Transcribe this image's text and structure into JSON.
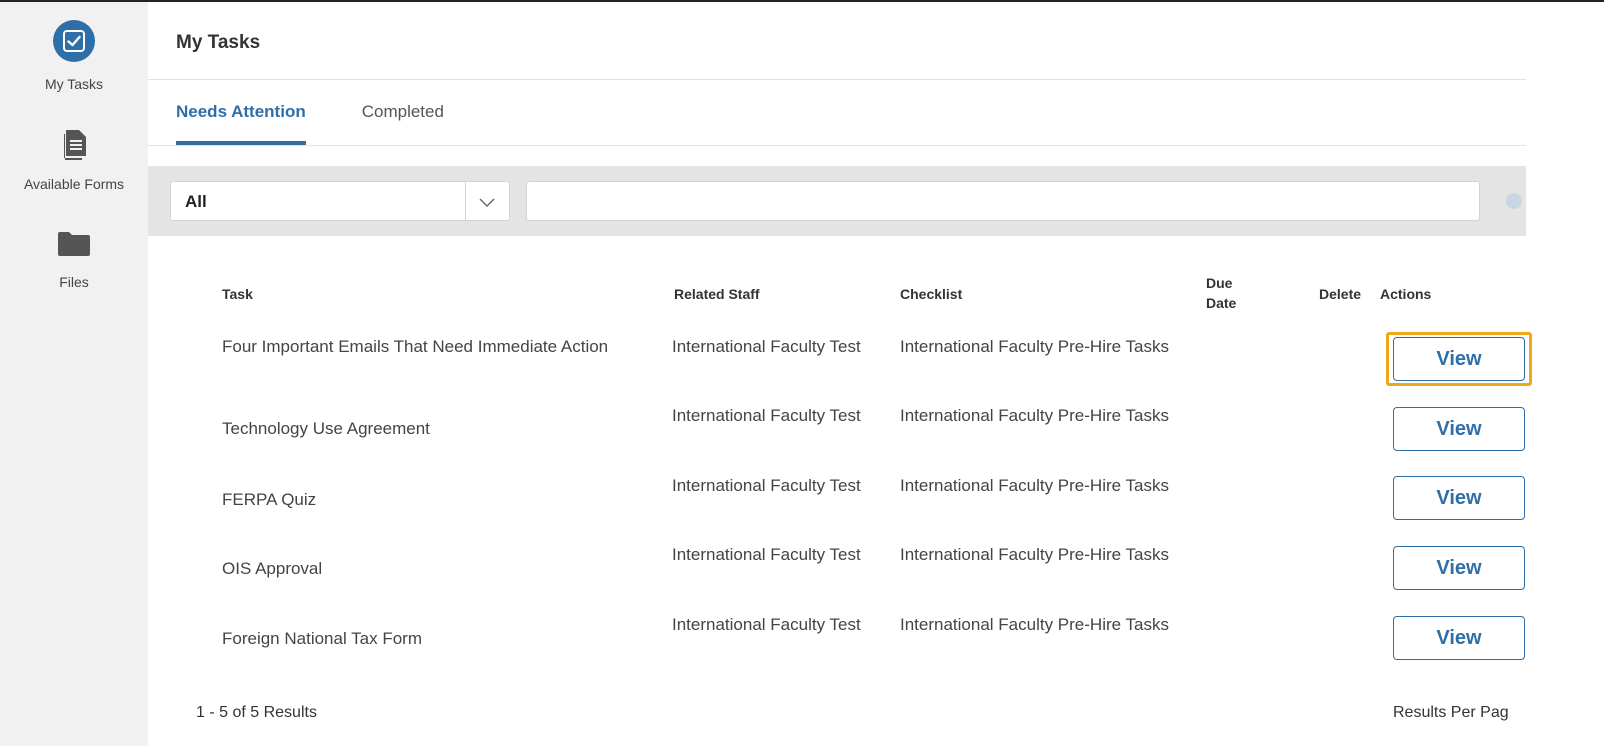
{
  "sidebar": {
    "items": [
      {
        "label": "My Tasks",
        "icon": "checkbox-icon",
        "active": true
      },
      {
        "label": "Available Forms",
        "icon": "document-icon"
      },
      {
        "label": "Files",
        "icon": "folder-icon"
      }
    ]
  },
  "header": {
    "title": "My Tasks"
  },
  "tabs": [
    {
      "label": "Needs Attention",
      "active": true
    },
    {
      "label": "Completed"
    }
  ],
  "filter": {
    "selected": "All",
    "search_value": ""
  },
  "table": {
    "headers": {
      "task": "Task",
      "related_staff": "Related Staff",
      "checklist": "Checklist",
      "due_date": "Due Date",
      "delete": "Delete",
      "actions": "Actions"
    },
    "rows": [
      {
        "task": "Four Important Emails That Need Immediate Action",
        "related_staff": "International Faculty Test",
        "checklist": "International Faculty Pre-Hire Tasks",
        "due_date": "",
        "action": "View"
      },
      {
        "task": "Technology Use Agreement",
        "related_staff": "International Faculty Test",
        "checklist": "International Faculty Pre-Hire Tasks",
        "due_date": "",
        "action": "View"
      },
      {
        "task": "FERPA Quiz",
        "related_staff": "International Faculty Test",
        "checklist": "International Faculty Pre-Hire Tasks",
        "due_date": "",
        "action": "View"
      },
      {
        "task": "OIS Approval",
        "related_staff": "International Faculty Test",
        "checklist": "International Faculty Pre-Hire Tasks",
        "due_date": "",
        "action": "View"
      },
      {
        "task": "Foreign National Tax Form",
        "related_staff": "International Faculty Test",
        "checklist": "International Faculty Pre-Hire Tasks",
        "due_date": "",
        "action": "View"
      }
    ]
  },
  "footer": {
    "results": "1 - 5 of 5 Results",
    "per_page_label": "Results Per Pag"
  },
  "colors": {
    "accent": "#2f6fa8",
    "focus": "#f0a819",
    "rail_bg": "#f1f1f1",
    "filter_bg": "#e4e4e4"
  }
}
